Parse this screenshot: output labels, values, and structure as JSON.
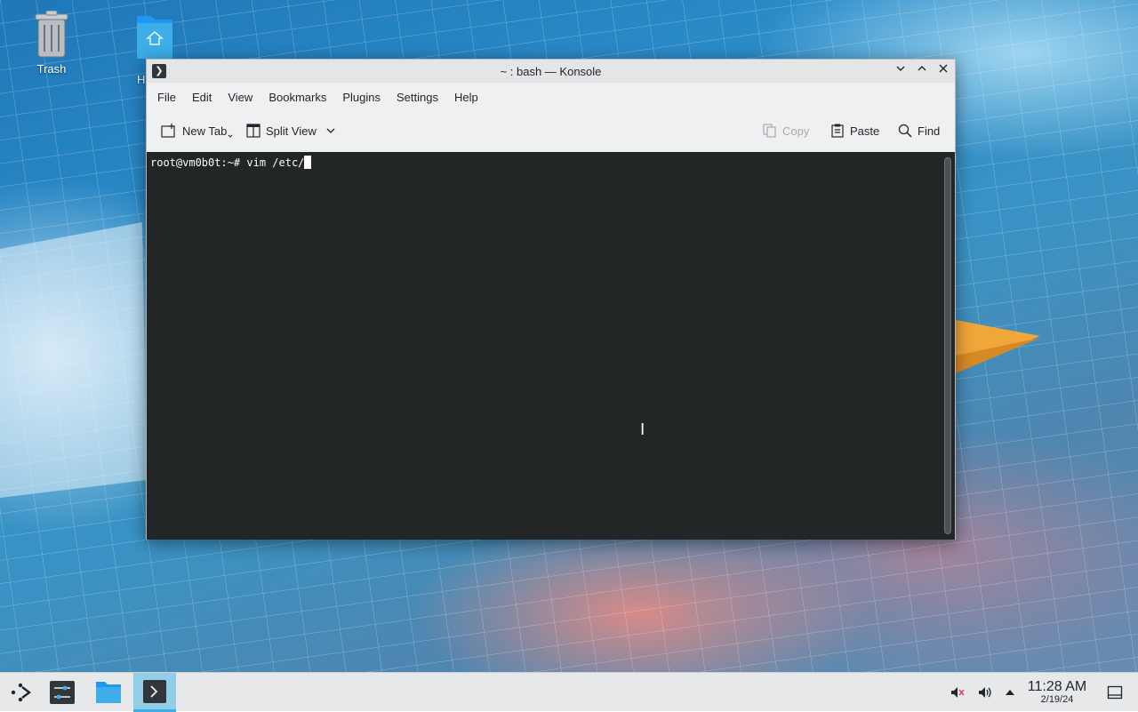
{
  "desktop": {
    "icons": [
      {
        "label": "Trash",
        "icon": "trash-icon"
      },
      {
        "label": "H",
        "icon": "home-folder-icon"
      }
    ]
  },
  "window": {
    "title": "~ : bash — Konsole",
    "app_icon": "terminal-icon",
    "controls": [
      "minimize-icon",
      "maximize-icon",
      "close-icon"
    ]
  },
  "menubar": {
    "items": [
      "File",
      "Edit",
      "View",
      "Bookmarks",
      "Plugins",
      "Settings",
      "Help"
    ]
  },
  "toolbar": {
    "new_tab": "New Tab",
    "split_view": "Split View",
    "copy": "Copy",
    "paste": "Paste",
    "find": "Find"
  },
  "terminal": {
    "prompt": "root@vm0b0t:~# ",
    "command": "vim /etc/"
  },
  "taskbar": {
    "launchers": [
      "application-launcher-icon",
      "system-settings-icon",
      "file-manager-icon",
      "konsole-icon"
    ],
    "tray": [
      "muted-microphone-icon",
      "volume-icon",
      "tray-expand-icon",
      "show-desktop-icon"
    ],
    "time": "11:28 AM",
    "date": "2/19/24"
  },
  "colors": {
    "accent": "#3daee9",
    "terminal_bg": "#232627",
    "terminal_fg": "#fcfcfc",
    "window_bg": "#eff0f1"
  }
}
